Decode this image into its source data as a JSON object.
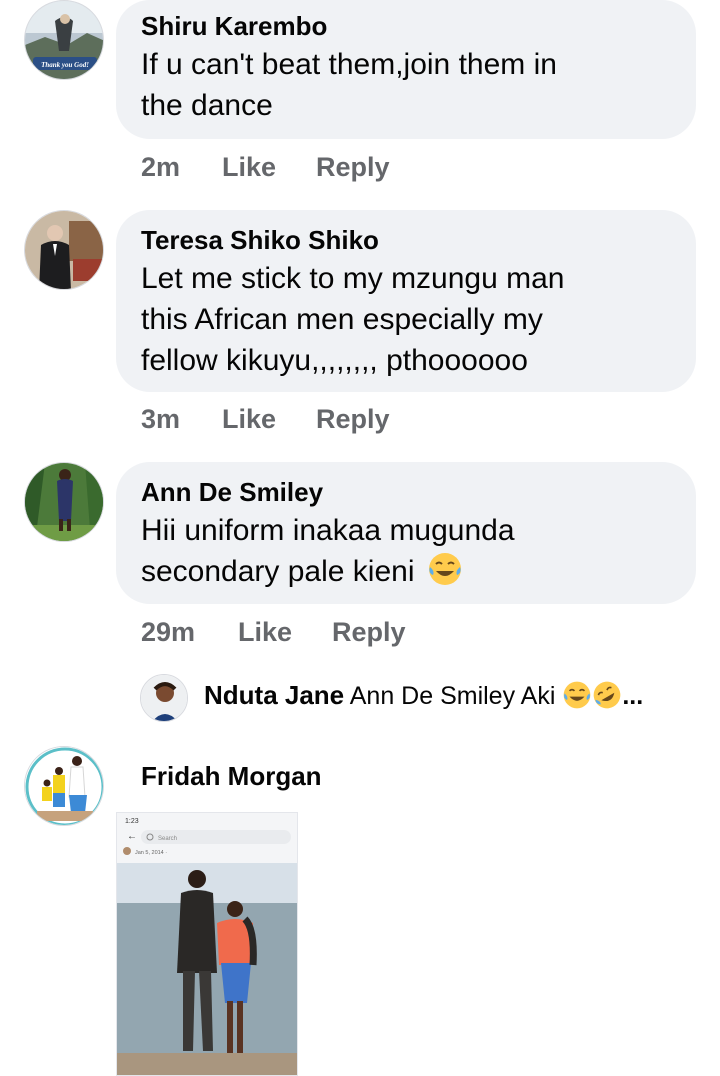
{
  "comments": [
    {
      "author": "Shiru Karembo",
      "text_lines": [
        "If u can't beat them,join them in",
        "the dance"
      ],
      "time": "2m",
      "like_label": "Like",
      "reply_label": "Reply",
      "avatar_caption": "Thank you God!"
    },
    {
      "author": "Teresa Shiko Shiko",
      "text_lines": [
        "Let me stick to my mzungu man",
        "this African men especially my",
        "fellow kikuyu,,,,,,,, pthoooooo"
      ],
      "time": "3m",
      "like_label": "Like",
      "reply_label": "Reply"
    },
    {
      "author": "Ann De Smiley",
      "text_lines": [
        "Hii uniform inakaa mugunda",
        "secondary pale kieni"
      ],
      "emoji": "face-with-tears-of-joy",
      "time": "29m",
      "like_label": "Like",
      "reply_label": "Reply",
      "reply": {
        "author": "Nduta Jane",
        "text": "Ann De Smiley Aki",
        "emojis": [
          "face-with-tears-of-joy",
          "rolling-on-floor-laughing"
        ],
        "ellipsis": "..."
      }
    },
    {
      "author": "Fridah Morgan",
      "attachment": {
        "status_text": "1:23",
        "search_placeholder": "Search",
        "date_text": "Jan 5, 2014 · "
      }
    }
  ],
  "colors": {
    "bubble": "#f0f2f5",
    "meta_text": "#65676b",
    "text": "#050505"
  }
}
